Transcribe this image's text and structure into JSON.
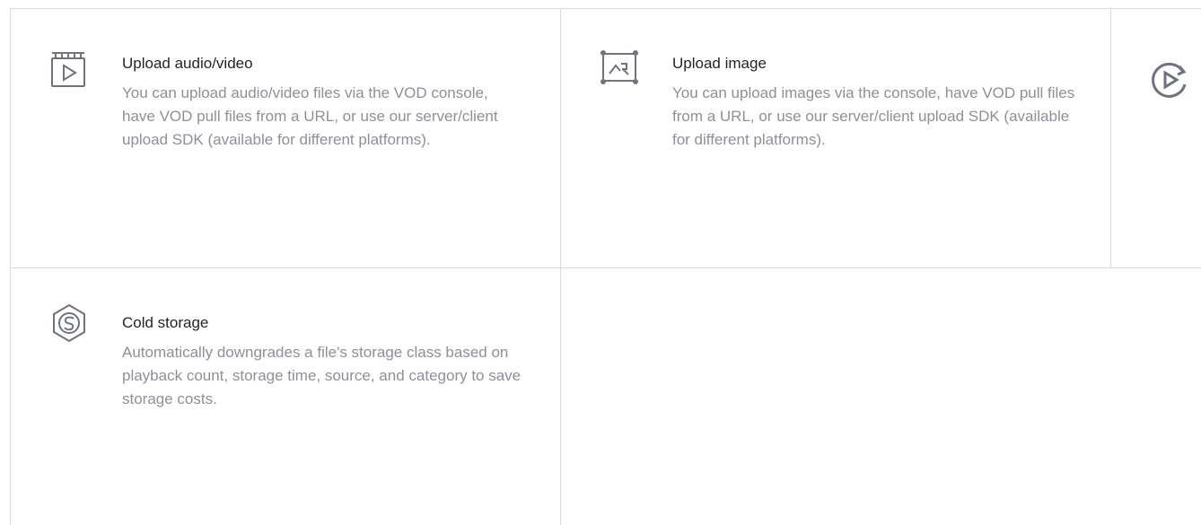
{
  "features": [
    {
      "icon": "video-upload-icon",
      "title": "Upload audio/video",
      "description": "You can upload audio/video files via the VOD console, have VOD pull files from a URL, or use our server/client upload SDK (available for different platforms)."
    },
    {
      "icon": "image-upload-icon",
      "title": "Upload image",
      "description": "You can upload images via the console, have VOD pull files from a URL, or use our server/client upload SDK (available for different platforms)."
    },
    {
      "icon": "playback-cycle-icon",
      "title": "",
      "description": ""
    },
    {
      "icon": "cold-storage-icon",
      "title": "Cold storage",
      "description": "Automatically downgrades a file's storage class based on playback count, storage time, source, and category to save storage costs."
    }
  ]
}
